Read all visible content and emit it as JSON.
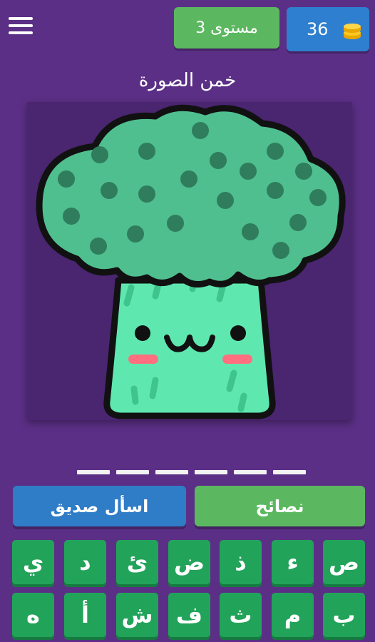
{
  "header": {
    "level_label": "مستوى 3",
    "coins": "36"
  },
  "title": "خمن الصورة",
  "answer_slots": 6,
  "actions": {
    "hints_label": "نصائح",
    "ask_friend_label": "اسأل صديق"
  },
  "keyboard": {
    "row1": [
      "ص",
      "ء",
      "ذ",
      "ض",
      "ئ",
      "د",
      "ي"
    ],
    "row2": [
      "ب",
      "م",
      "ث",
      "ف",
      "ش",
      "أ",
      "ه"
    ]
  },
  "colors": {
    "background": "#5b2f86",
    "key_green": "#22a35a",
    "hints_green": "#5cb860",
    "ask_blue": "#2f7cc7",
    "coin_blue": "#2e7fcf",
    "broccoli_head": "#4fbf8f",
    "broccoli_stem": "#5ee8b0"
  },
  "icons": {
    "menu": "hamburger-icon",
    "coins": "coin-stack-icon",
    "picture": "broccoli-image"
  }
}
